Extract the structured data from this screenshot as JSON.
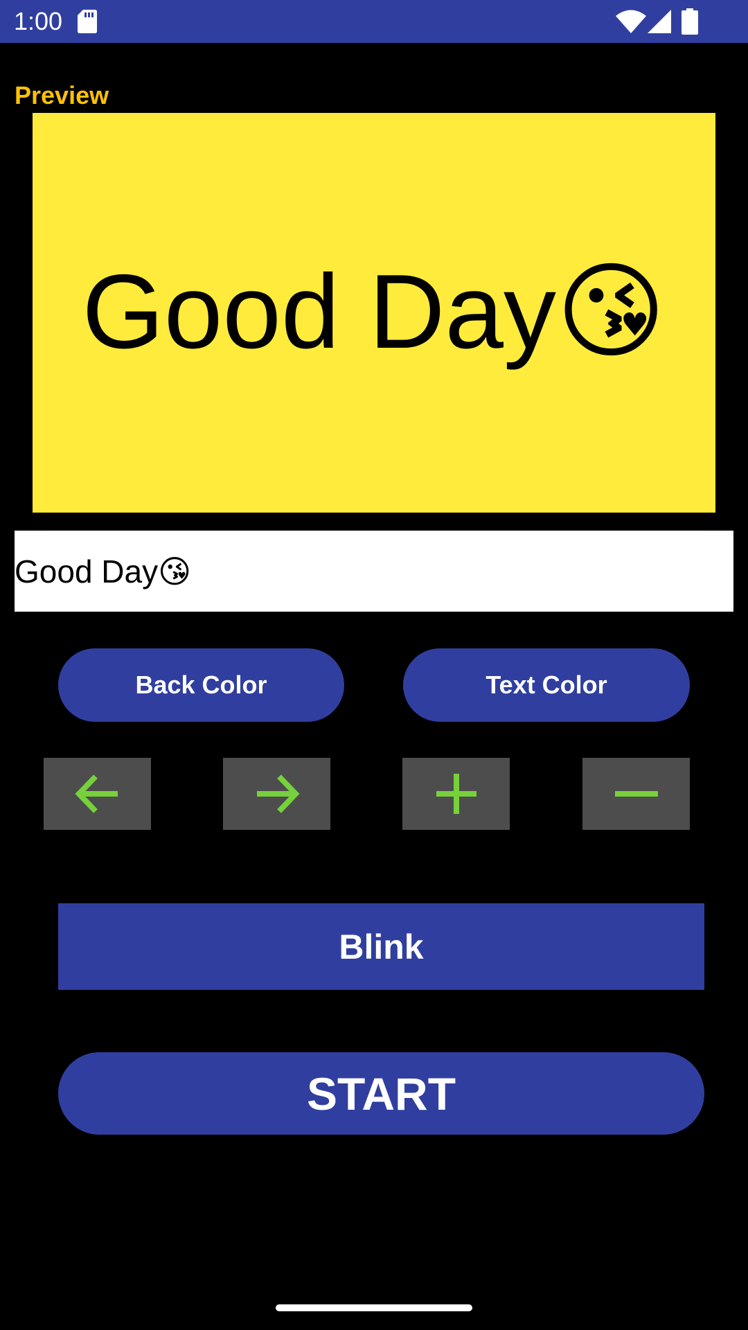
{
  "status_bar": {
    "time": "1:00",
    "icons": [
      "sd-card-icon",
      "wifi-icon",
      "signal-icon",
      "battery-icon"
    ],
    "background_color": "#303f9f"
  },
  "preview": {
    "label": "Preview",
    "label_color": "#ffc107",
    "display_text": "Good Day😘",
    "background_color": "#ffeb3b",
    "text_color": "#000000"
  },
  "input": {
    "value": "Good Day😘"
  },
  "buttons": {
    "back_color": "Back Color",
    "text_color": "Text Color",
    "blink": "Blink",
    "start": "START",
    "accent_color": "#303f9f"
  },
  "controls": [
    {
      "icon": "arrow-left-icon"
    },
    {
      "icon": "arrow-right-icon"
    },
    {
      "icon": "plus-icon"
    },
    {
      "icon": "minus-icon"
    }
  ],
  "control_icon_color": "#76d13a",
  "control_background_color": "#4d4d4d"
}
